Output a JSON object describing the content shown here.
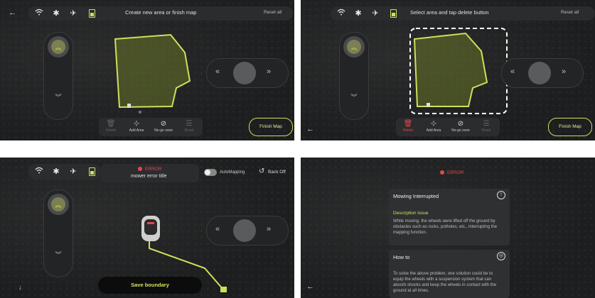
{
  "status_icons": [
    "wifi-icon",
    "bluetooth-icon",
    "satellite-icon",
    "battery-icon"
  ],
  "colors": {
    "accent": "#cfe05a",
    "error": "#e8454a",
    "background": "#1d1e1f"
  },
  "panel1": {
    "title": "Create new area or finish map",
    "reset": "Reset all",
    "finish": "Finish Map",
    "tools": [
      {
        "label": "Delete"
      },
      {
        "label": "Add Area"
      },
      {
        "label": "No-go zone"
      },
      {
        "label": "Reset"
      }
    ]
  },
  "panel2": {
    "title": "Select area and tap delete button",
    "reset": "Reset all",
    "finish": "Finish Map",
    "tools": [
      {
        "label": "Delete"
      },
      {
        "label": "Add Area"
      },
      {
        "label": "No-go zone"
      },
      {
        "label": "Reset"
      }
    ]
  },
  "panel3": {
    "error_label": "ERROR",
    "error_title": "mower error title",
    "automapping_label": "AutoMapping",
    "automapping_on": false,
    "back_off": "Back Off",
    "save": "Save boundary"
  },
  "panel4": {
    "error_label": "ERROR",
    "card1": {
      "title": "Mowing Interrupted",
      "heading": "Description issue",
      "body": "While moving, the wheels were lifted off the ground by obstacles such as rocks, potholes, etc., interrupting the mapping function."
    },
    "card2": {
      "title": "How to",
      "body": "To solve the above problem, one solution could be to equip the wheels with a suspension system that can absorb shocks and keep the wheels in contact with the ground at all times."
    }
  }
}
